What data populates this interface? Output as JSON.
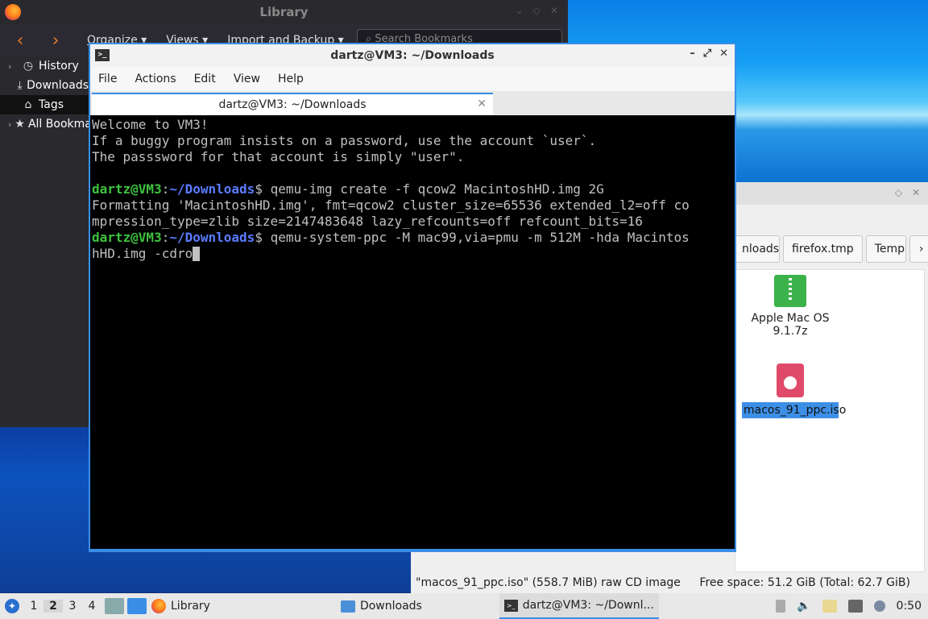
{
  "library": {
    "title": "Library",
    "toolbar": {
      "back": "‹",
      "forward": "›",
      "organize": "Organize ▾",
      "views": "Views ▾",
      "import_backup": "Import and Backup ▾"
    },
    "search_placeholder": "Search Bookmarks",
    "sidebar": [
      {
        "label": "History",
        "icon": "clock-icon"
      },
      {
        "label": "Downloads",
        "icon": "download-icon"
      },
      {
        "label": "Tags",
        "icon": "tag-icon"
      },
      {
        "label": "All Bookmarks",
        "icon": "star-icon"
      }
    ]
  },
  "file_manager": {
    "path_buttons": [
      "nloads",
      "firefox.tmp",
      "Temp"
    ],
    "items": [
      {
        "label": "Apple Mac OS 9.1.7z",
        "icon": "zip-archive-icon"
      },
      {
        "label": "macos_91_ppc.iso",
        "icon": "disc-image-icon",
        "selected": true
      }
    ],
    "status_left": "\"macos_91_ppc.iso\" (558.7 MiB) raw CD image",
    "status_right": "Free space: 51.2 GiB (Total: 62.7 GiB)"
  },
  "terminal": {
    "title": "dartz@VM3: ~/Downloads",
    "menu": [
      "File",
      "Actions",
      "Edit",
      "View",
      "Help"
    ],
    "tab_label": "dartz@VM3: ~/Downloads",
    "welcome": [
      "Welcome to VM3!",
      "If a buggy program insists on a password, use the account `user`.",
      "The passsword for that account is simply \"user\"."
    ],
    "prompt_user": "dartz@VM3",
    "prompt_sep": ":",
    "prompt_path": "~/Downloads",
    "prompt_end": "$ ",
    "cmd1": "qemu-img create -f qcow2 MacintoshHD.img 2G",
    "out1a": "Formatting 'MacintoshHD.img', fmt=qcow2 cluster_size=65536 extended_l2=off co",
    "out1b": "mpression_type=zlib size=2147483648 lazy_refcounts=off refcount_bits=16",
    "cmd2a": "qemu-system-ppc -M mac99,via=pmu -m 512M -hda Macintos",
    "cmd2b": "hHD.img -cdro"
  },
  "taskbar": {
    "workspaces": [
      "1",
      "2",
      "3",
      "4"
    ],
    "active_workspace": "2",
    "tasks": [
      {
        "label": "Library",
        "icon": "firefox-icon"
      },
      {
        "label": "Downloads",
        "icon": "folder-icon"
      },
      {
        "label": "dartz@VM3: ~/Downl...",
        "icon": "terminal-icon",
        "active": true
      }
    ],
    "clock": "0:50"
  }
}
